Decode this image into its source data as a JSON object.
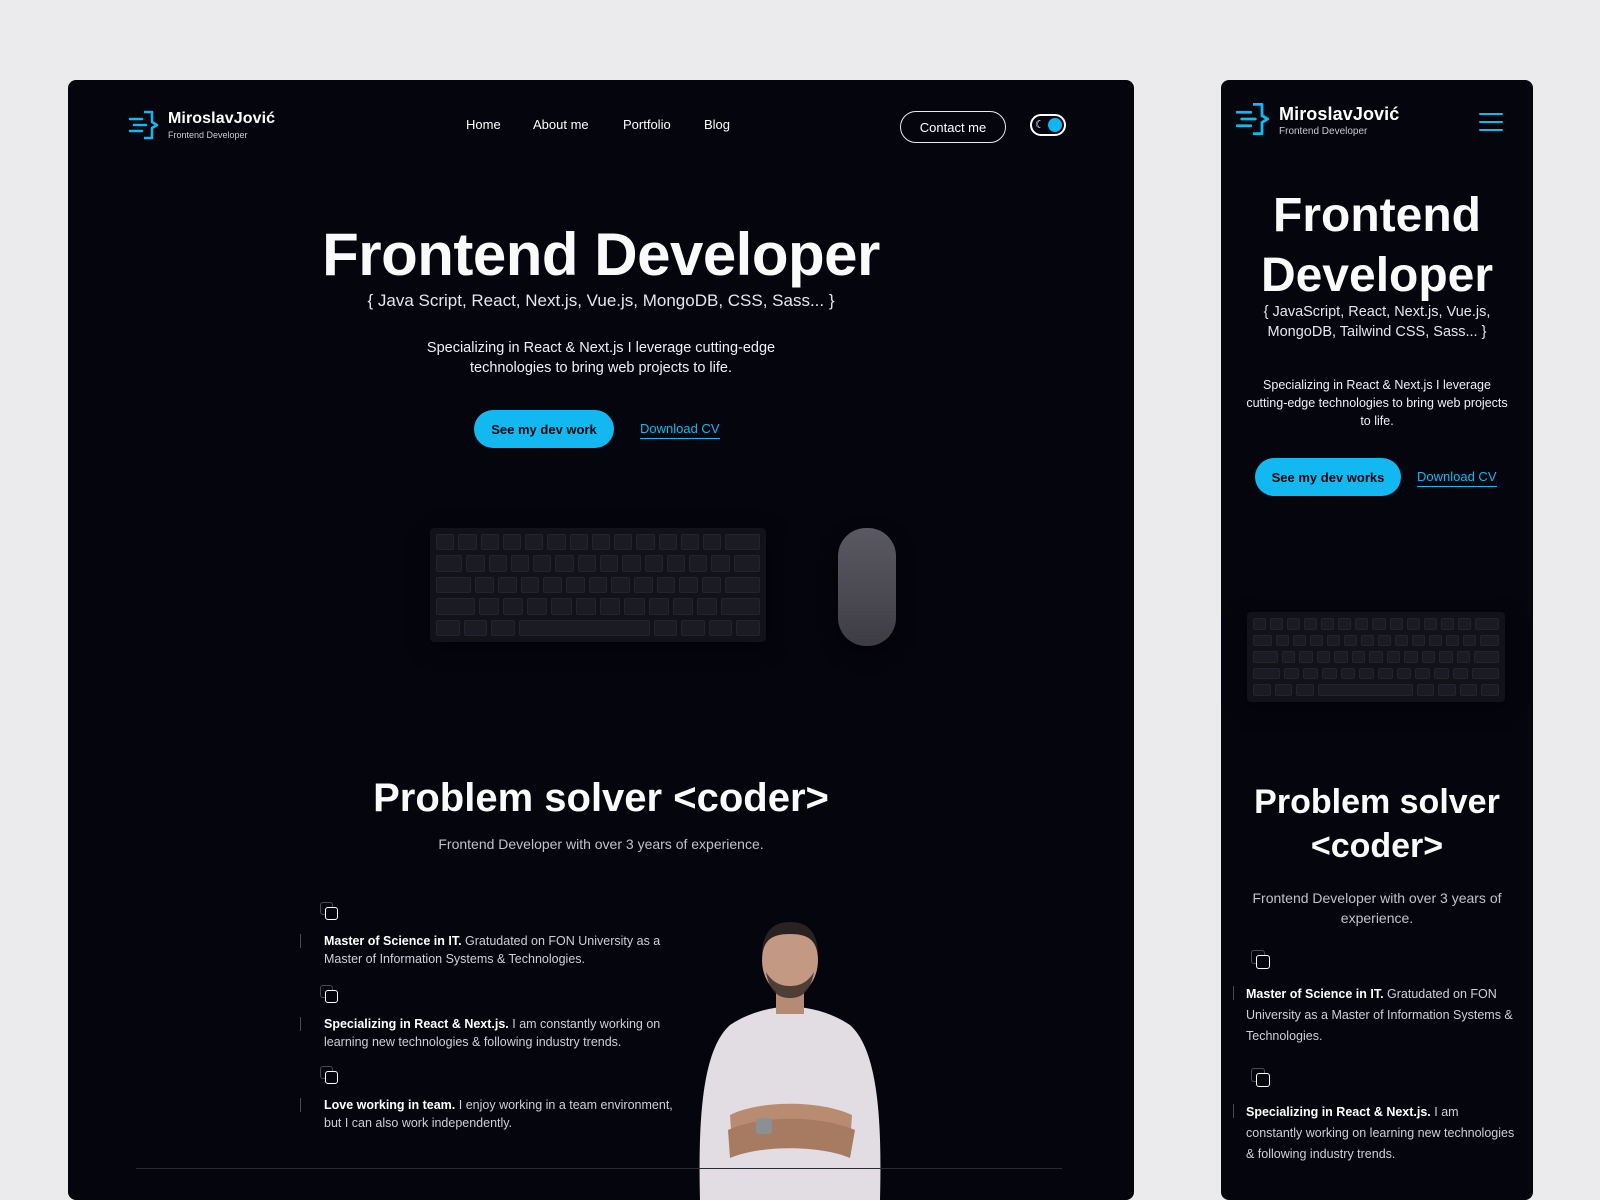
{
  "brand": {
    "name": "MiroslavJović",
    "tagline": "Frontend Developer",
    "accent": "#12b8f0",
    "background": "#05050e"
  },
  "desktop": {
    "nav": {
      "items": [
        "Home",
        "About me",
        "Portfolio",
        "Blog"
      ],
      "contact_label": "Contact me",
      "theme_toggle_icon": "moon-icon"
    },
    "hero": {
      "title": "Frontend Developer",
      "tech": "{ Java Script, React, Next.js, Vue.js, MongoDB, CSS, Sass... }",
      "description": "Specializing in React & Next.js I leverage cutting-edge technologies to bring web projects to life.",
      "cta_label": "See my dev work",
      "cv_label": "Download CV"
    },
    "about": {
      "title": "Problem solver <coder>",
      "subtitle": "Frontend Developer with over 3 years of experience.",
      "features": [
        {
          "title": "Master of Science in IT.",
          "text": "Gratudated on FON University as a Master of Information Systems & Technologies."
        },
        {
          "title": "Specializing in React & Next.js.",
          "text": "I am constantly working on learning new technologies & following industry trends."
        },
        {
          "title": "Love working in team.",
          "text": "I enjoy working in a team environment, but I can also work independently."
        }
      ]
    }
  },
  "mobile": {
    "menu_icon": "hamburger-menu-icon",
    "hero": {
      "title": "Frontend Developer",
      "tech": "{ JavaScript, React, Next.js, Vue.js, MongoDB, Tailwind CSS, Sass... }",
      "description": "Specializing in React & Next.js I leverage cutting-edge technologies to bring web projects to life.",
      "cta_label": "See my dev works",
      "cv_label": "Download CV"
    },
    "about": {
      "title": "Problem solver <coder>",
      "subtitle": "Frontend Developer with over 3 years of experience.",
      "features": [
        {
          "title": "Master of Science in IT.",
          "text": "Gratudated on FON University as a Master of Information Systems & Technologies."
        },
        {
          "title": "Specializing in React & Next.js.",
          "text": "I am constantly working on learning new technologies & following industry trends."
        }
      ]
    }
  }
}
